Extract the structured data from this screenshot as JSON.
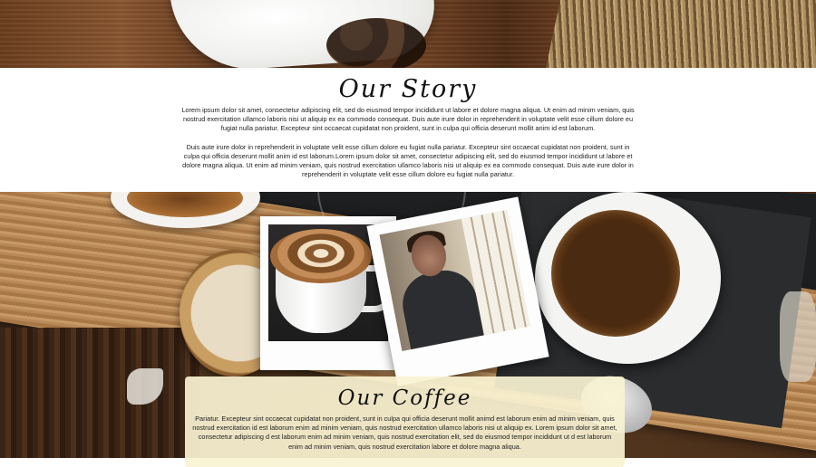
{
  "story": {
    "title": "Our Story",
    "paragraph_1": "Lorem ipsum dolor sit amet, consectetur adipiscing elit, sed do eiusmod tempor incididunt ut labore et dolore magna aliqua. Ut enim ad minim veniam, quis nostrud exercitation ullamco laboris nisi ut aliquip ex ea commodo consequat. Duis aute irure dolor in reprehenderit in voluptate velit esse cillum dolore eu fugiat nulla pariatur. Excepteur sint occaecat cupidatat non proident, sunt in culpa qui officia deserunt mollit anim id est laborum.",
    "paragraph_2": "Duis aute irure dolor in reprehenderit in voluptate velit esse cillum dolore eu fugiat nulla pariatur. Excepteur sint occaecat cupidatat non proident, sunt in culpa qui officia deserunt mollit anim id est laborum.Lorem ipsum dolor sit amet, consectetur adipiscing elit, sed do eiusmod tempor incididunt ut labore et dolore magna aliqua. Ut enim ad minim veniam, quis nostrud exercitation ullamco laboris nisi ut aliquip ex ea commodo consequat. Duis aute irure dolor in reprehenderit in voluptate velit esse cillum dolore eu fugiat nulla pariatur."
  },
  "coffee": {
    "title": "Our Coffee",
    "paragraph": "Pariatur. Excepteur sint occaecat cupidatat non proident, sunt in culpa qui officia deserunt mollit animd est laborum enim ad minim veniam, quis nostrud exercitation id est laborum enim ad minim veniam, quis nostrud exercitation ullamco laboris nisi ut aliquip ex. Lorem ipsum dolor sit amet, consectetur adipiscing d est laborum enim ad minim veniam, quis nostrud exercitation elit, sed do eiusmod tempor incididunt ut d est laborum enim ad minim veniam, quis nostrud exercitation labore et dolore magna aliqua."
  },
  "colors": {
    "coffee_panel_bg": "#faf3d2",
    "text": "#222222"
  }
}
